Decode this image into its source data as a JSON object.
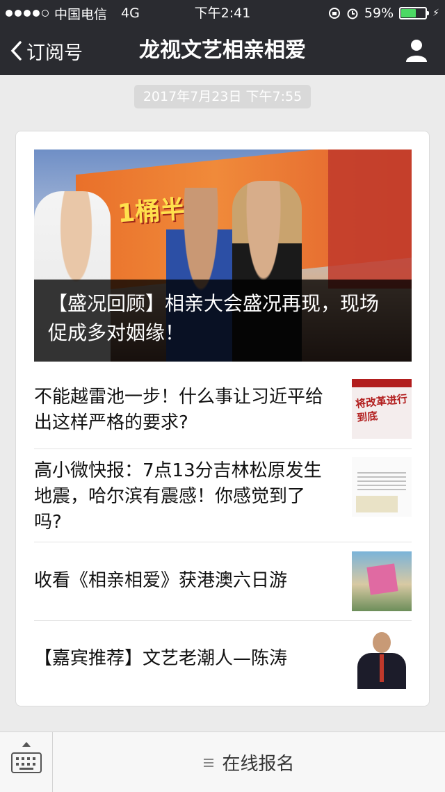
{
  "status_bar": {
    "carrier": "中国电信",
    "network": "4G",
    "time": "下午2:41",
    "battery_percent": "59%",
    "battery_level": 0.59,
    "icons": [
      "rotation-lock-icon",
      "alarm-icon",
      "battery-icon",
      "charging-icon"
    ],
    "signal_bars_filled": 4,
    "signal_bars_total": 5
  },
  "nav": {
    "back_label": "订阅号",
    "title": "龙视文艺相亲相爱",
    "right_icon": "user-icon"
  },
  "message": {
    "timestamp": "2017年7月23日 下午7:55"
  },
  "article_card": {
    "hero": {
      "caption": "【盛况回顾】相亲大会盛况再现，现场促成多对姻缘！",
      "banner_text": "1桶半"
    },
    "items": [
      {
        "title": "不能越雷池一步！什么事让习近平给出这样严格的要求?",
        "thumb_text": "将改革进行到底"
      },
      {
        "title": "高小微快报：7点13分吉林松原发生地震，哈尔滨有震感！你感觉到了吗?"
      },
      {
        "title": "收看《相亲相爱》获港澳六日游"
      },
      {
        "title": "【嘉宾推荐】文艺老潮人—陈涛"
      }
    ]
  },
  "bottom_bar": {
    "keyboard_icon": "keyboard-icon",
    "menu_label": "在线报名",
    "menu_icon": "menu-lines-icon"
  },
  "colors": {
    "header_bg": "#2a2b30",
    "page_bg": "#ebebeb",
    "battery_green": "#4cd964"
  }
}
